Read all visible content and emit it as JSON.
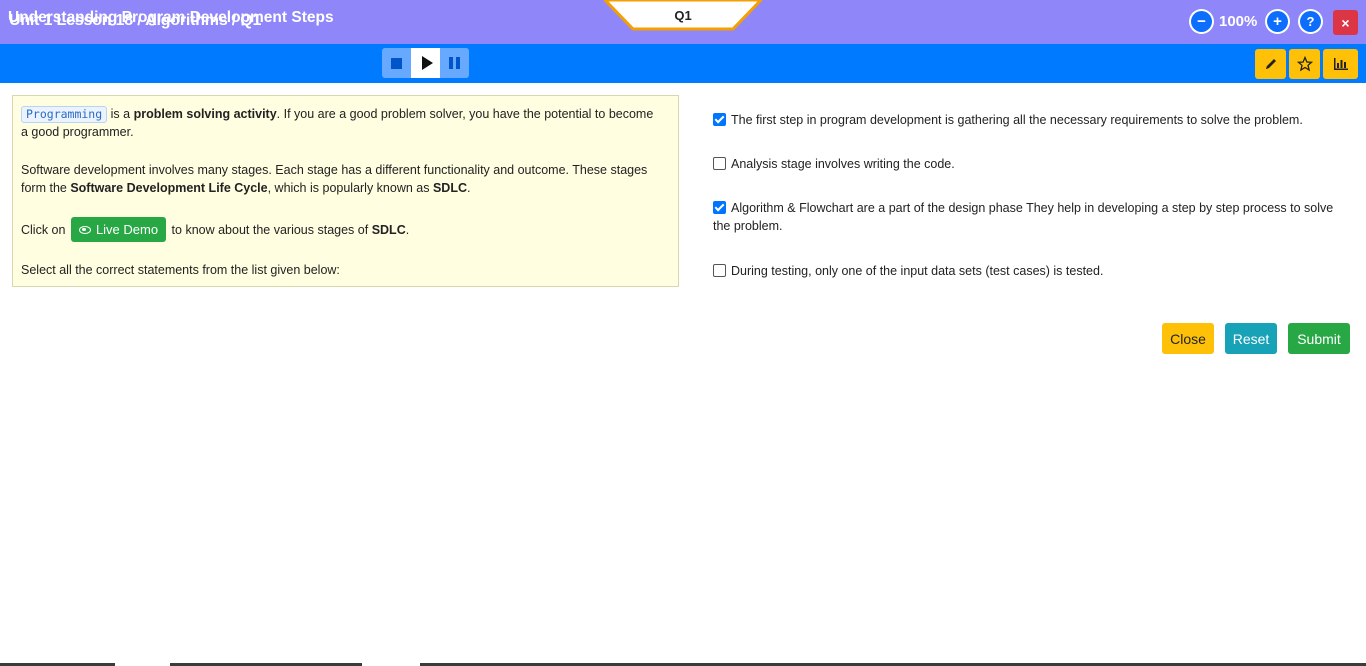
{
  "topbar": {
    "breadcrumb": "Unit 1 Lesson 18 / Algorithms / Q1",
    "question_tab": "Q1",
    "zoom_minus_glyph": "−",
    "zoom_level": "100%",
    "zoom_plus_glyph": "+",
    "help_glyph": "?",
    "close_glyph": "×",
    "colors": {
      "bar": "#8f86f9",
      "tab_border": "#f5a000",
      "close": "#dc3545"
    }
  },
  "header": {
    "title": "Understanding Program Development Steps",
    "media_controls": [
      {
        "icon": "stop-icon",
        "active": false
      },
      {
        "icon": "play-icon",
        "active": true
      },
      {
        "icon": "pause-icon",
        "active": false
      }
    ],
    "tools": [
      {
        "icon": "pencil-icon"
      },
      {
        "icon": "star-icon"
      },
      {
        "icon": "bar-chart-icon"
      }
    ],
    "colors": {
      "bar": "#007bff",
      "tool": "#ffc107"
    }
  },
  "info": {
    "p1": {
      "code_tag": "Programming",
      "text_a": " is a ",
      "bold_a": "problem solving activity",
      "text_b": ". If you are a good problem solver, you have the potential to become a good programmer."
    },
    "p2": {
      "text_a": "Software development involves many stages. Each stage has a different functionality and outcome. These stages form the ",
      "bold_a": "Software Development Life Cycle",
      "text_b": ", which is popularly known as ",
      "bold_b": "SDLC",
      "text_c": "."
    },
    "p3": {
      "text_a": "Click on ",
      "button_label": "Live Demo",
      "text_b": " to know about the various stages of ",
      "bold_a": "SDLC",
      "text_c": "."
    },
    "p4": "Select all the correct statements from the list given below:",
    "colors": {
      "panel": "#fffee1",
      "live_demo": "#28a745"
    }
  },
  "options": [
    {
      "text": "The first step in program development is gathering all the necessary requirements to solve the problem.",
      "checked": true
    },
    {
      "text": "Analysis stage involves writing the code.",
      "checked": false
    },
    {
      "text": "Algorithm & Flowchart are a part of the design phase They help in developing a step by step process to solve the problem.",
      "checked": true
    },
    {
      "text": "During testing, only one of the input data sets (test cases) is tested.",
      "checked": false
    }
  ],
  "actions": {
    "close_label": "Close",
    "reset_label": "Reset",
    "submit_label": "Submit",
    "colors": {
      "close": "#ffc107",
      "reset": "#17a2b8",
      "submit": "#28a745"
    }
  }
}
